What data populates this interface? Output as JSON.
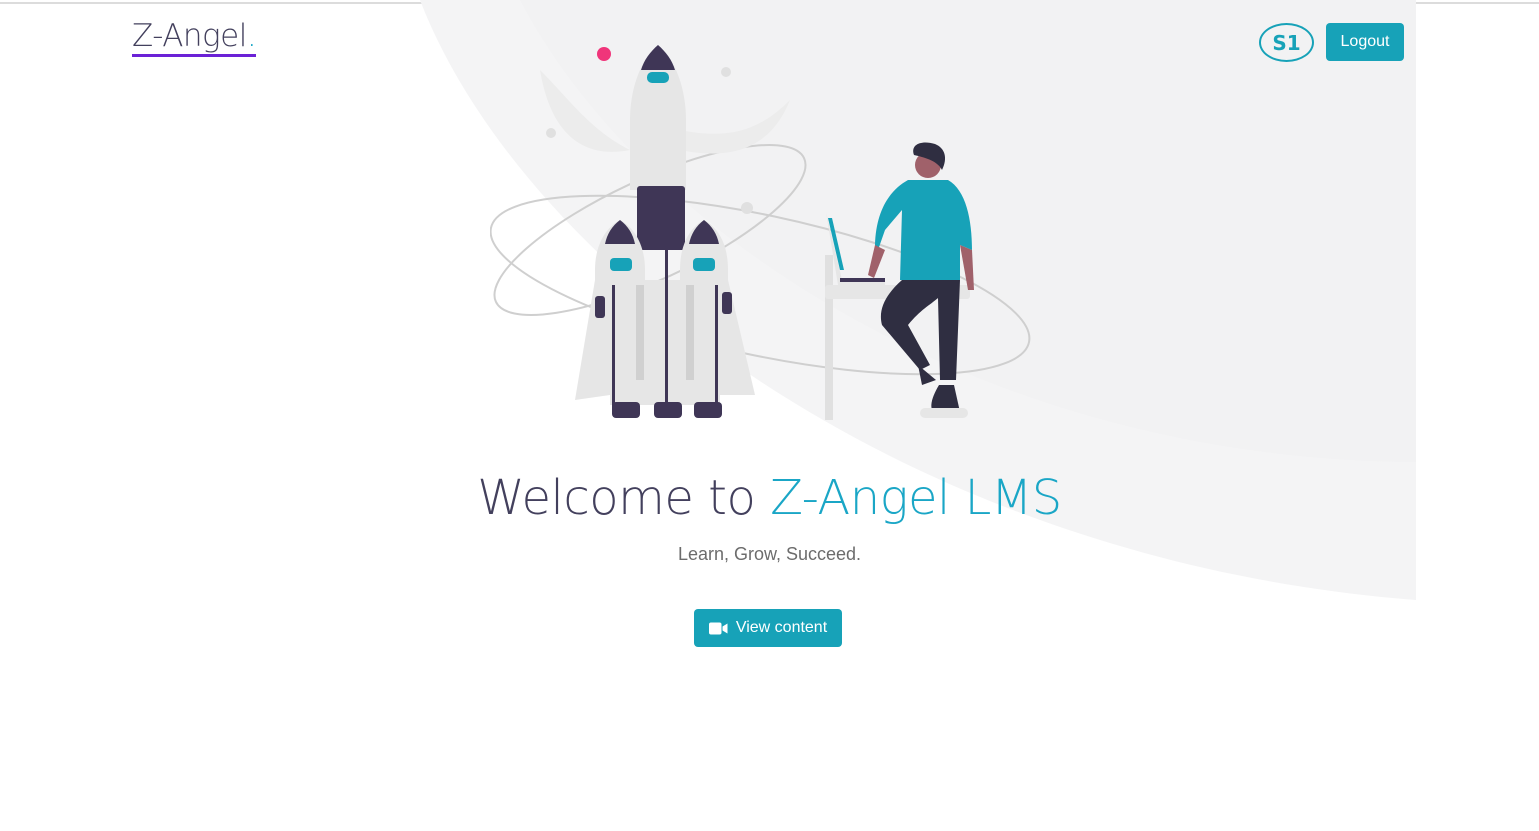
{
  "header": {
    "logo_text": "Z-Angel",
    "logo_dot": ".",
    "avatar_initials": "S1",
    "logout_label": "Logout"
  },
  "hero": {
    "title_prefix": "Welcome to",
    "title_accent": "Z-Angel LMS",
    "subtitle": "Learn, Grow, Succeed.",
    "cta_label": "View content",
    "cta_icon": "video-camera-icon",
    "illustration": "rocket-launch-illustration"
  },
  "colors": {
    "accent": "#17a2b8",
    "title": "#43405d",
    "logo_underline": "#6b21d6"
  }
}
